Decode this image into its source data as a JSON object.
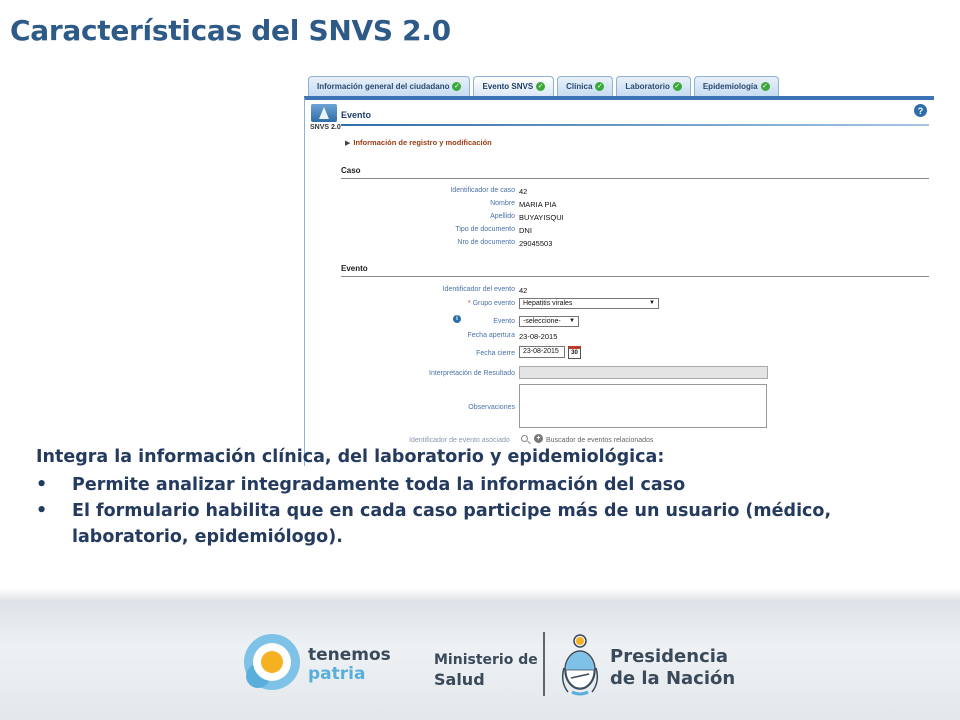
{
  "slide": {
    "title": "Características del SNVS 2.0"
  },
  "tabs": [
    {
      "label": "Información general del ciudadano"
    },
    {
      "label": "Evento SNVS"
    },
    {
      "label": "Clínica"
    },
    {
      "label": "Laboratorio"
    },
    {
      "label": "Epidemiología"
    }
  ],
  "app": {
    "logo_text": "SNVS 2.0",
    "panel_title": "Evento",
    "help_glyph": "?",
    "registro_link": "Información de registro y modificación"
  },
  "caso": {
    "section_title": "Caso",
    "fields": [
      {
        "label": "Identificador de caso",
        "value": "42"
      },
      {
        "label": "Nombre",
        "value": "MARIA PIA"
      },
      {
        "label": "Apellido",
        "value": "BUYAYISQUI"
      },
      {
        "label": "Tipo de documento",
        "value": "DNI"
      },
      {
        "label": "Nro de documento",
        "value": "29045503"
      }
    ]
  },
  "evento": {
    "section_title": "Evento",
    "id_label": "Identificador del evento",
    "id_value": "42",
    "grupo_required": "*",
    "grupo_label": "Grupo evento",
    "grupo_value": "Hepatitis virales",
    "evento_label": "Evento",
    "evento_value": "-seleccione-",
    "fecha_apertura_label": "Fecha apertura",
    "fecha_apertura_value": "23-08-2015",
    "fecha_cierre_label": "Fecha cierre",
    "fecha_cierre_value": "23-08-2015",
    "calendar_day": "30",
    "interpretacion_label": "Interpretación de Resultado",
    "observaciones_label": "Observaciones",
    "asociado_label": "Identificador de evento asociado",
    "buscador_label": "Buscador de eventos relacionados"
  },
  "body": {
    "intro": "Integra la información clínica, del laboratorio y epidemiológica:",
    "bullets": [
      "Permite analizar integradamente toda la información del caso",
      "El formulario habilita que en cada caso participe más de un usuario (médico, laboratorio, epidemiólogo)."
    ]
  },
  "footer": {
    "tenemos": "tenemos",
    "patria": "patria",
    "ministerio_l1": "Ministerio de",
    "ministerio_l2": "Salud",
    "presidencia_l1": "Presidencia",
    "presidencia_l2": "de la Nación"
  }
}
